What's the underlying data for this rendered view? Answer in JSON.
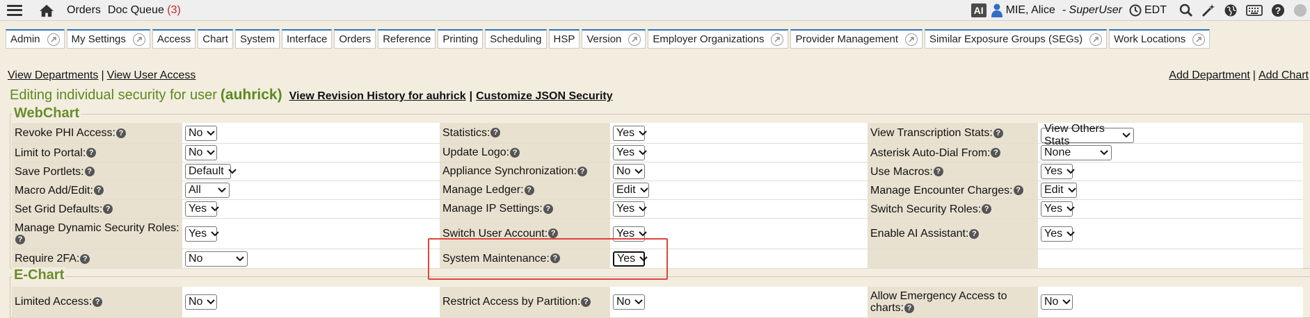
{
  "topbar": {
    "orders": "Orders",
    "doc_queue": "Doc Queue",
    "doc_queue_count": "(3)",
    "ai_badge": "AI",
    "user_name": "MIE, Alice",
    "user_role": "- SuperUser",
    "timezone": "EDT",
    "icons": [
      "menu-icon",
      "home-icon",
      "user-icon",
      "clock-icon",
      "search-icon",
      "wand-icon",
      "globe-icon",
      "keyboard-icon",
      "help-icon",
      "status-icon"
    ]
  },
  "tabs": [
    {
      "label": "Admin",
      "arrow": true
    },
    {
      "label": "My Settings",
      "arrow": true
    },
    {
      "label": "Access",
      "arrow": false
    },
    {
      "label": "Chart",
      "arrow": false
    },
    {
      "label": "System",
      "arrow": false
    },
    {
      "label": "Interface",
      "arrow": false
    },
    {
      "label": "Orders",
      "arrow": false
    },
    {
      "label": "Reference",
      "arrow": false
    },
    {
      "label": "Printing",
      "arrow": false
    },
    {
      "label": "Scheduling",
      "arrow": false
    },
    {
      "label": "HSP",
      "arrow": false
    },
    {
      "label": "Version",
      "arrow": true
    },
    {
      "label": "Employer Organizations",
      "arrow": true
    },
    {
      "label": "Provider Management",
      "arrow": true
    },
    {
      "label": "Similar Exposure Groups (SEGs)",
      "arrow": true
    },
    {
      "label": "Work Locations",
      "arrow": true
    }
  ],
  "links": {
    "view_departments": "View Departments",
    "view_user_access": "View User Access",
    "add_department": "Add Department",
    "add_chart": "Add Chart",
    "sep": "|"
  },
  "heading": {
    "prefix": "Editing individual security for user",
    "user_id": "(auhrick)",
    "revision": "View Revision History for auhrick",
    "customize": "Customize JSON Security",
    "sep": "|"
  },
  "sections": {
    "webchart": "WebChart",
    "echart": "E-Chart"
  },
  "webchart_rows": [
    [
      {
        "label": "Revoke PHI Access:",
        "value": "No"
      },
      {
        "label": "Statistics:",
        "value": "Yes"
      },
      {
        "label": "View Transcription Stats:",
        "value": "View Others Stats"
      }
    ],
    [
      {
        "label": "Limit to Portal:",
        "value": "No"
      },
      {
        "label": "Update Logo:",
        "value": "Yes"
      },
      {
        "label": "Asterisk Auto-Dial From:",
        "value": "None"
      }
    ],
    [
      {
        "label": "Save Portlets:",
        "value": "Default"
      },
      {
        "label": "Appliance Synchronization:",
        "value": "No"
      },
      {
        "label": "Use Macros:",
        "value": "Yes"
      }
    ],
    [
      {
        "label": "Macro Add/Edit:",
        "value": "All"
      },
      {
        "label": "Manage Ledger:",
        "value": "Edit"
      },
      {
        "label": "Manage Encounter Charges:",
        "value": "Edit"
      }
    ],
    [
      {
        "label": "Set Grid Defaults:",
        "value": "Yes"
      },
      {
        "label": "Manage IP Settings:",
        "value": "Yes"
      },
      {
        "label": "Switch Security Roles:",
        "value": "Yes"
      }
    ],
    [
      {
        "label": "Manage Dynamic Security Roles:",
        "value": "Yes"
      },
      {
        "label": "Switch User Account:",
        "value": "Yes"
      },
      {
        "label": "Enable AI Assistant:",
        "value": "Yes"
      }
    ],
    [
      {
        "label": "Require 2FA:",
        "value": "No"
      },
      {
        "label": "System Maintenance:",
        "value": "Yes"
      },
      {
        "label": "",
        "value": ""
      }
    ]
  ],
  "echart_rows": [
    [
      {
        "label": "Limited Access:",
        "value": "No"
      },
      {
        "label": "Restrict Access by Partition:",
        "value": "No"
      },
      {
        "label": "Allow Emergency Access to charts:",
        "value": "No"
      }
    ]
  ],
  "colors": {
    "accent_green": "#5a8a1c",
    "highlight_red": "#e0443e",
    "tab_border": "#2e73b8",
    "background": "#f3ede0"
  }
}
